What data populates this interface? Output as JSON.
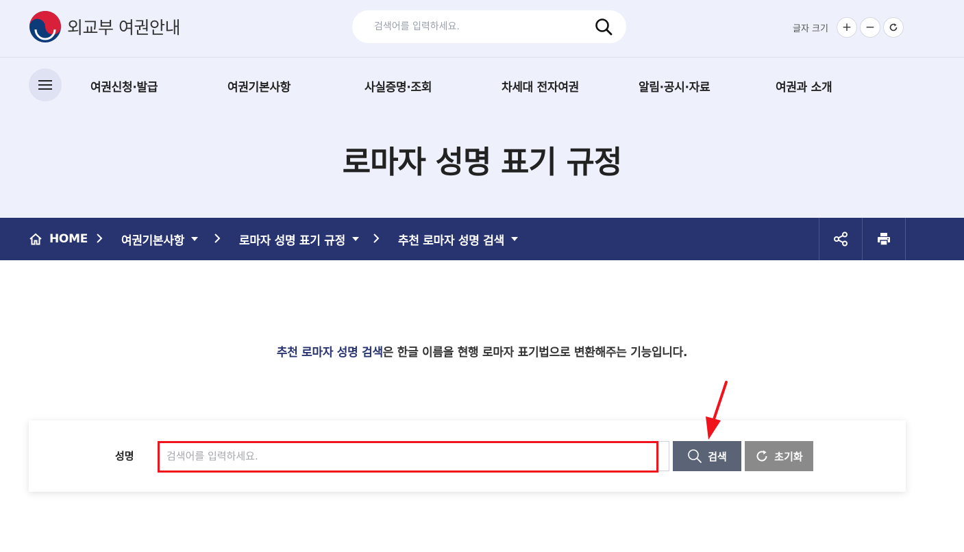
{
  "header": {
    "logo_text": "외교부 여권안내",
    "search_placeholder": "검색어를 입력하세요.",
    "font_size_label": "글자 크기",
    "font_plus": "+",
    "font_minus": "−"
  },
  "nav": {
    "items": [
      {
        "label": "여권신청·발급"
      },
      {
        "label": "여권기본사항"
      },
      {
        "label": "사실증명·조회"
      },
      {
        "label": "차세대 전자여권"
      },
      {
        "label": "알림·공시·자료"
      },
      {
        "label": "여권과 소개"
      }
    ]
  },
  "page": {
    "title": "로마자 성명 표기 규정"
  },
  "breadcrumb": {
    "home": "HOME",
    "items": [
      {
        "label": "여권기본사항"
      },
      {
        "label": "로마자 성명 표기 규정"
      },
      {
        "label": "추천 로마자 성명 검색"
      }
    ]
  },
  "intro": {
    "highlight": "추천 로마자 성명 검색",
    "rest": "은 한글 이름을 현행 로마자 표기법으로 변환해주는 기능입니다."
  },
  "form": {
    "label": "성명",
    "placeholder": "검색어를 입력하세요.",
    "value": "",
    "search_label": "검색",
    "reset_label": "초기화"
  },
  "colors": {
    "header_bg": "#eef0fc",
    "breadcrumb_bg": "#283470",
    "search_button": "#5b6377",
    "reset_button": "#8a8a8a",
    "annotation": "#f0131c"
  }
}
